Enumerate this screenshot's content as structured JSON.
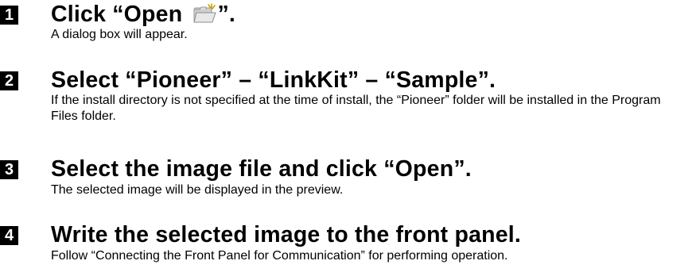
{
  "steps": [
    {
      "number": "1",
      "title_before": "Click “Open ",
      "title_after": "”.",
      "icon": "open-folder-icon",
      "description": "A dialog box will appear."
    },
    {
      "number": "2",
      "title": "Select “Pioneer” – “LinkKit” – “Sample”.",
      "description": "If the install directory is not specified at the time of install, the “Pioneer” folder will be installed in the Program Files folder."
    },
    {
      "number": "3",
      "title": "Select the image file and click “Open”.",
      "description": "The selected image will be displayed in the preview."
    },
    {
      "number": "4",
      "title": "Write the selected image to the front panel.",
      "description": "Follow “Connecting the Front Panel for Communication” for performing operation."
    }
  ]
}
